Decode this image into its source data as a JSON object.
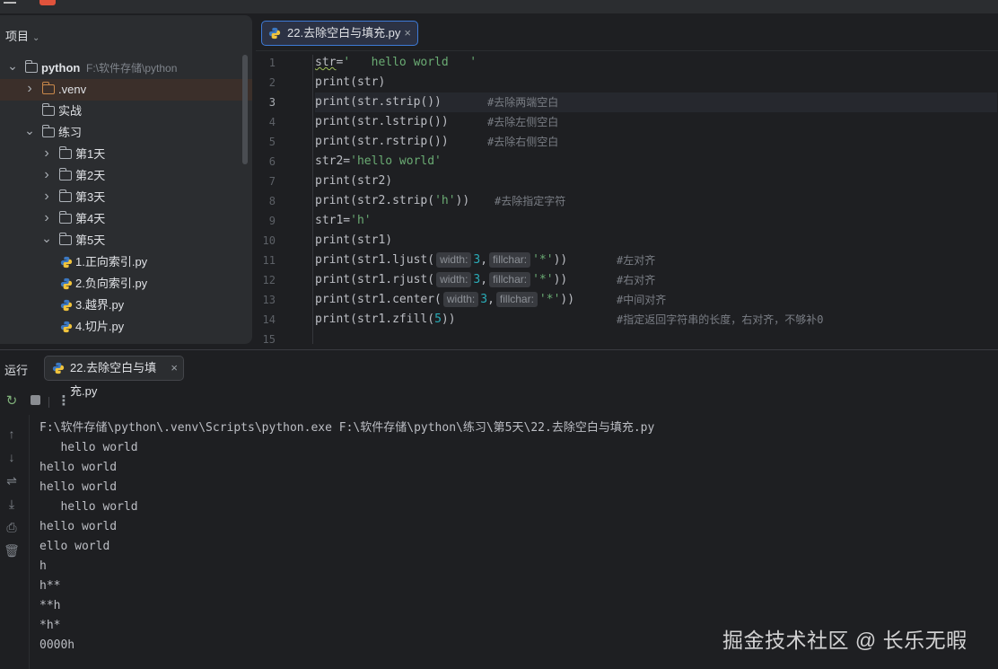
{
  "project_panel": {
    "title": "项目",
    "tree": [
      {
        "label": "python",
        "path": "F:\\软件存储\\python",
        "bold": true,
        "expanded": true,
        "indent": 0
      },
      {
        "label": ".venv",
        "expanded": false,
        "indent": 1,
        "selected": true,
        "venv": true
      },
      {
        "label": "实战",
        "indent": 1,
        "leaf_folder": true
      },
      {
        "label": "练习",
        "expanded": true,
        "indent": 1
      },
      {
        "label": "第1天",
        "expanded": false,
        "indent": 2
      },
      {
        "label": "第2天",
        "expanded": false,
        "indent": 2
      },
      {
        "label": "第3天",
        "expanded": false,
        "indent": 2
      },
      {
        "label": "第4天",
        "expanded": false,
        "indent": 2
      },
      {
        "label": "第5天",
        "expanded": true,
        "indent": 2
      },
      {
        "label": "1.正向索引.py",
        "file": true,
        "indent": 3
      },
      {
        "label": "2.负向索引.py",
        "file": true,
        "indent": 3
      },
      {
        "label": "3.越界.py",
        "file": true,
        "indent": 3
      },
      {
        "label": "4.切片.py",
        "file": true,
        "indent": 3
      }
    ]
  },
  "editor": {
    "tab_label": "22.去除空白与填充.py",
    "current_line": 3,
    "lines": [
      {
        "n": "1",
        "html": "<span class=\"squig\">str</span>=<span class=\"str\">'   hello world   '</span>",
        "comment": ""
      },
      {
        "n": "2",
        "html": "print(str)",
        "comment": ""
      },
      {
        "n": "3",
        "html": "print(str.strip())",
        "comment": "#去除两端空白"
      },
      {
        "n": "4",
        "html": "print(str.lstrip())",
        "comment": "#去除左侧空白"
      },
      {
        "n": "5",
        "html": "print(str.rstrip())",
        "comment": "#去除右侧空白"
      },
      {
        "n": "6",
        "html": "str2=<span class=\"str\">'hello world'</span>",
        "comment": ""
      },
      {
        "n": "7",
        "html": "print(str2)",
        "comment": ""
      },
      {
        "n": "8",
        "html": "print(str2.strip(<span class=\"str\">'h'</span>))",
        "comment": "#去除指定字符"
      },
      {
        "n": "9",
        "html": "str1=<span class=\"str\">'h'</span>",
        "comment": ""
      },
      {
        "n": "10",
        "html": "print(str1)",
        "comment": ""
      },
      {
        "n": "11",
        "html": "print(str1.ljust(<span class=\"hint\">width:</span><span class=\"num\">3</span>,<span class=\"hint\">fillchar:</span><span class=\"str\">'*'</span>))",
        "comment": "#左对齐"
      },
      {
        "n": "12",
        "html": "print(str1.rjust(<span class=\"hint\">width:</span><span class=\"num\">3</span>,<span class=\"hint\">fillchar:</span><span class=\"str\">'*'</span>))",
        "comment": "#右对齐"
      },
      {
        "n": "13",
        "html": "print(str1.center(<span class=\"hint\">width:</span><span class=\"num\">3</span>,<span class=\"hint\">fillchar:</span><span class=\"str\">'*'</span>))",
        "comment": "#中间对齐"
      },
      {
        "n": "14",
        "html": "print(str1.zfill(<span class=\"num\">5</span>))",
        "comment": "#指定返回字符串的长度，右对齐，不够补0"
      },
      {
        "n": "15",
        "html": "",
        "comment": ""
      }
    ]
  },
  "run_panel": {
    "title": "运行",
    "tab_label": "22.去除空白与填充.py",
    "output": [
      "F:\\软件存储\\python\\.venv\\Scripts\\python.exe F:\\软件存储\\python\\练习\\第5天\\22.去除空白与填充.py",
      "   hello world",
      "hello world",
      "hello world",
      "   hello world",
      "hello world",
      "ello world",
      "h",
      "h**",
      "**h",
      "*h*",
      "0000h"
    ]
  },
  "watermark": "掘金技术社区 @ 长乐无暇",
  "colors": {
    "background": "#1e1f22",
    "panel": "#2b2d30",
    "string": "#6aab73",
    "number": "#2aacb8",
    "comment": "#7a7e85",
    "selection": "#3b2f2a",
    "tab_border": "#3d7ad6"
  }
}
